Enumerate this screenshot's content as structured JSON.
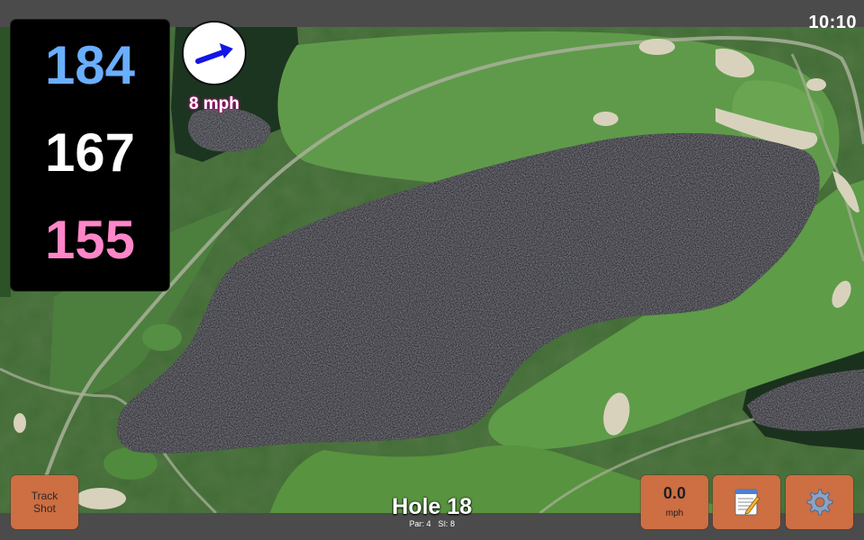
{
  "status": {
    "clock": "10:10"
  },
  "distances": {
    "back": "184",
    "middle": "167",
    "front": "155"
  },
  "distance_colors": {
    "back": "#6aaeff",
    "middle": "#ffffff",
    "front": "#ff86c8"
  },
  "wind": {
    "speed_label": "8 mph",
    "icon": "wind-direction-arrow-icon",
    "arrow_color": "#1515e6"
  },
  "buttons": {
    "track_shot": {
      "line1": "Track",
      "line2": "Shot"
    },
    "speed": {
      "value": "0.0",
      "unit": "mph"
    },
    "notes": {
      "icon": "notepad-icon"
    },
    "settings": {
      "icon": "gear-icon"
    }
  },
  "button_color": "#cd6e43",
  "hole": {
    "title": "Hole 18",
    "par_label": "Par: 4",
    "si_label": "SI: 8"
  }
}
